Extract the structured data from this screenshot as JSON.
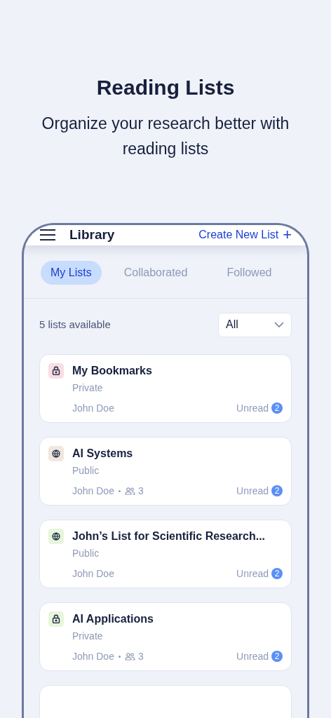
{
  "heading": {
    "title": "Reading Lists",
    "subtitle": "Organize your research better with reading lists"
  },
  "app_bar": {
    "title": "Library",
    "action": "Create New List",
    "action_icon": "+"
  },
  "tabs": [
    {
      "label": "My Lists",
      "selected": true
    },
    {
      "label": "Collaborated",
      "selected": false
    },
    {
      "label": "Followed",
      "selected": false
    }
  ],
  "summary": "5 lists available",
  "filter": {
    "value": "All"
  },
  "lists": [
    {
      "kind": "lock",
      "color": "#f8dde4",
      "title": "My Bookmarks",
      "visibility": "Private",
      "owner": "John Doe",
      "unread_label": "Unread",
      "unread": "2"
    },
    {
      "kind": "globe",
      "color": "#f1e7df",
      "title": "AI Systems",
      "visibility": "Public",
      "owner": "John Doe",
      "members": "3",
      "unread_label": "Unread",
      "unread": "2"
    },
    {
      "kind": "globe",
      "color": "#e6f5dc",
      "title": "John’s List for Scientific Research...",
      "visibility": "Public",
      "owner": "John Doe",
      "unread_label": "Unread",
      "unread": "2"
    },
    {
      "kind": "lock",
      "color": "#e8f5dc",
      "title": "AI Applications",
      "visibility": "Private",
      "owner": "John Doe",
      "members": "3",
      "unread_label": "Unread",
      "unread": "2"
    }
  ]
}
